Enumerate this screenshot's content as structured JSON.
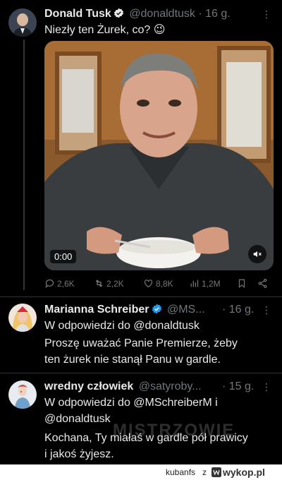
{
  "tweet": {
    "author": "Donald Tusk",
    "handle": "@donaldtusk",
    "time": "· 16 g.",
    "text": "Niezły ten Żurek, co? 😉",
    "video_time": "0:00",
    "stats": {
      "replies": "2,6K",
      "reposts": "2,2K",
      "likes": "8,8K",
      "views": "1,2M"
    }
  },
  "reply1": {
    "author": "Marianna Schreiber",
    "handle": "@MS...",
    "time": "· 16 g.",
    "replying": "W odpowiedzi do @donaldtusk",
    "text_line1": "Proszę uważać Panie Premierze, żeby",
    "text_line2": "ten żurek nie stanął Panu w gardle."
  },
  "reply2": {
    "author": "wredny człowiek",
    "handle": "@satyroby...",
    "time": "· 15 g.",
    "replying_line1": "W odpowiedzi do @MSchreiberM i",
    "replying_line2": "@donaldtusk",
    "text_line1": "Kochana, Ty miałaś w gardle pół prawicy",
    "text_line2": "i jakoś żyjesz."
  },
  "watermark": "MISTRZOWIE",
  "footer": {
    "user": "kubanfs",
    "z": "z",
    "site": "wykop.pl"
  },
  "colors": {
    "bg": "#000000",
    "verified": "#1d9bf0",
    "muted": "#71767b"
  }
}
